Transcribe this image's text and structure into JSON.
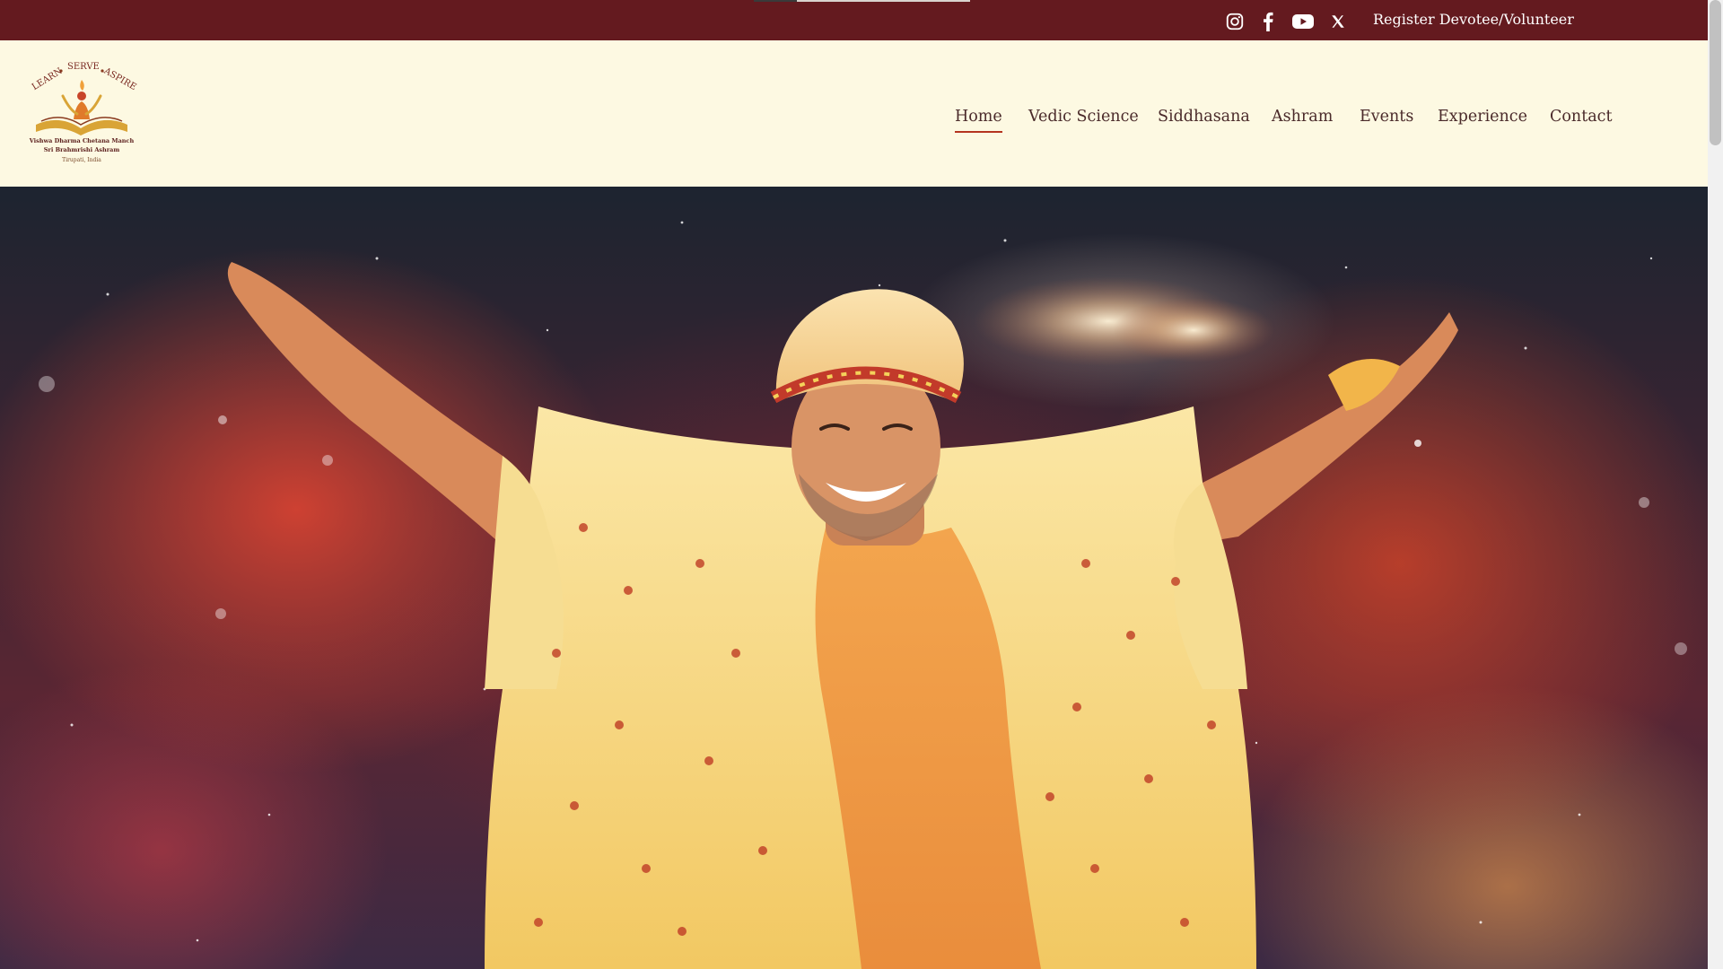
{
  "topbar": {
    "register_label": "Register Devotee/Volunteer",
    "social": [
      "instagram-icon",
      "facebook-icon",
      "youtube-icon",
      "x-icon"
    ]
  },
  "logo": {
    "word1": "LEARN",
    "word2": "SERVE",
    "word3": "ASPIRE",
    "line1": "Vishwa Dharma Chetana Manch",
    "line2": "Sri Brahmrishi Ashram",
    "line3": "Tirupati, India"
  },
  "nav": {
    "items": [
      {
        "label": "Home",
        "active": true
      },
      {
        "label": "Vedic Science",
        "active": false
      },
      {
        "label": "Siddhasana",
        "active": false
      },
      {
        "label": "Ashram",
        "active": false
      },
      {
        "label": "Events",
        "active": false
      },
      {
        "label": "Experience",
        "active": false
      },
      {
        "label": "Contact",
        "active": false
      }
    ]
  },
  "colors": {
    "topbar": "#641a1f",
    "header_bg": "#fdf9e2",
    "nav_text": "#4a2a2a",
    "active_underline": "#b5341f",
    "robe": "#f7d27a"
  }
}
